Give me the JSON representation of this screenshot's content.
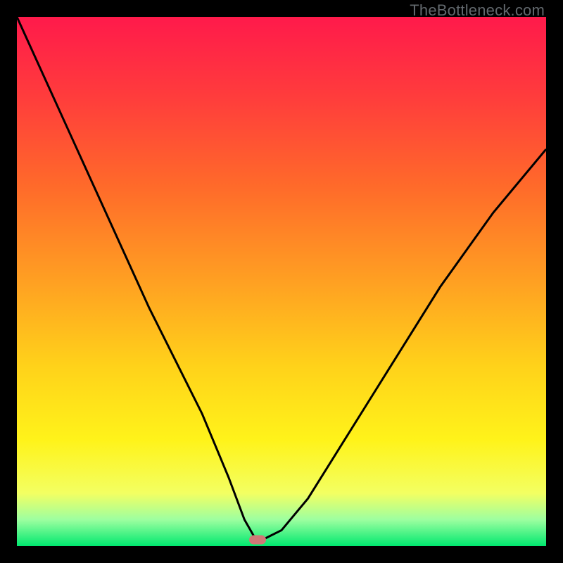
{
  "watermark": {
    "text": "TheBottleneck.com"
  },
  "colors": {
    "black": "#000000",
    "watermark": "#62686d",
    "curve": "#000000",
    "marker": "#cf7876",
    "gradient_stops": [
      {
        "pct": 0,
        "color": "#ff1a4b"
      },
      {
        "pct": 15,
        "color": "#ff3c3c"
      },
      {
        "pct": 32,
        "color": "#ff6a2a"
      },
      {
        "pct": 50,
        "color": "#ffa022"
      },
      {
        "pct": 66,
        "color": "#ffd21a"
      },
      {
        "pct": 80,
        "color": "#fff31a"
      },
      {
        "pct": 90,
        "color": "#f3ff62"
      },
      {
        "pct": 95,
        "color": "#9dffa0"
      },
      {
        "pct": 100,
        "color": "#00e86f"
      }
    ]
  },
  "chart_data": {
    "type": "line",
    "title": "",
    "xlabel": "",
    "ylabel": "",
    "xlim": [
      0,
      100
    ],
    "ylim": [
      0,
      100
    ],
    "grid": false,
    "legend": false,
    "series": [
      {
        "name": "bottleneck-curve",
        "x": [
          0,
          5,
          10,
          15,
          20,
          25,
          30,
          35,
          40,
          43,
          45,
          47,
          50,
          55,
          60,
          65,
          70,
          75,
          80,
          85,
          90,
          95,
          100
        ],
        "y": [
          100,
          89,
          78,
          67,
          56,
          45,
          35,
          25,
          13,
          5,
          1.5,
          1.5,
          3,
          9,
          17,
          25,
          33,
          41,
          49,
          56,
          63,
          69,
          75
        ]
      }
    ],
    "marker": {
      "x": 45.5,
      "y": 1.2
    }
  }
}
